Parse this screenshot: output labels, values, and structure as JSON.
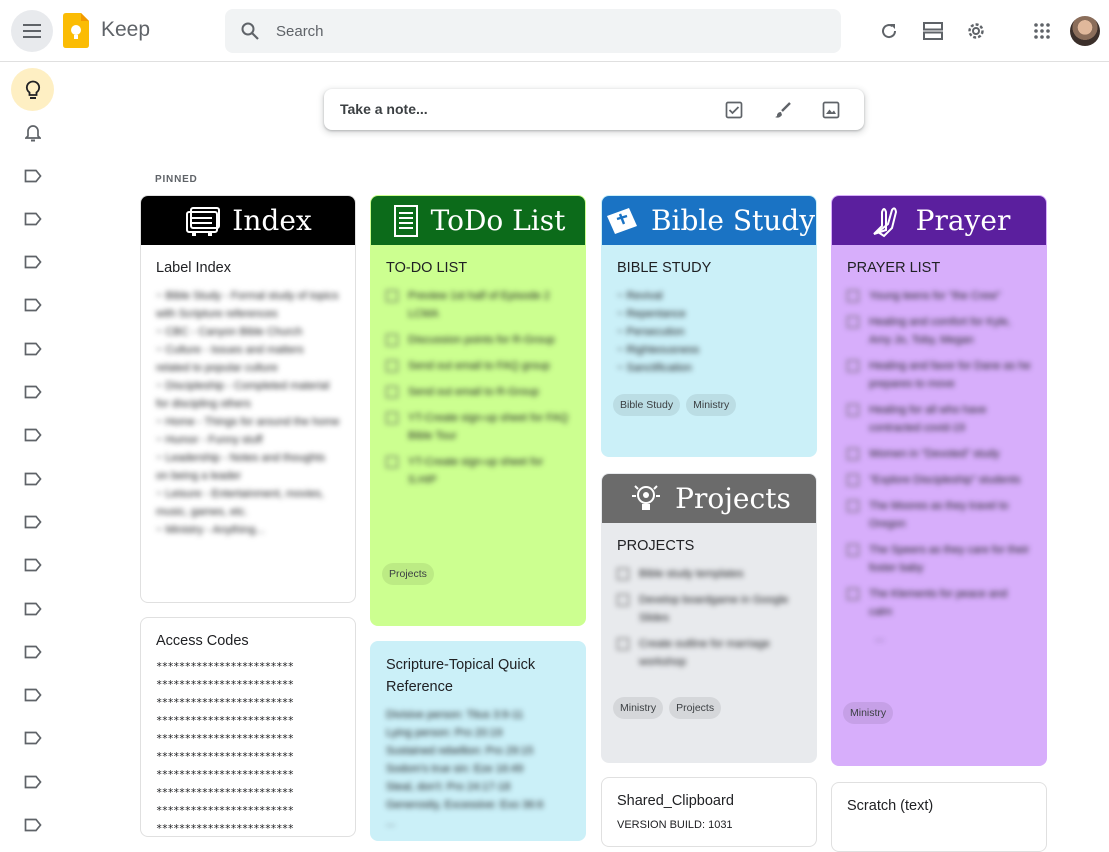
{
  "app": {
    "title": "Keep"
  },
  "search": {
    "placeholder": "Search"
  },
  "note_input": {
    "placeholder": "Take a note..."
  },
  "pinned_label": "PINNED",
  "colors": {
    "yellow_active": "#feefc3",
    "green": "#ccff90",
    "blue": "#cbf0f8",
    "gray": "#e8eaed",
    "purple": "#d7aefb"
  },
  "cards": {
    "index": {
      "banner": "Index",
      "title": "Label Index",
      "body": [
        "~ Bible Study - Formal study of topics with Scripture references",
        "~ CBC - Canyon Bible Church",
        "~ Culture - Issues and matters related to popular culture",
        "~ Discipleship - Completed material for discipling others",
        "~ Home - Things for around the home",
        "~ Humor - Funny stuff",
        "~ Leadership - Notes and thoughts on being a leader",
        "~ Leisure - Entertainment, movies, music, games, etc.",
        "~ Ministry - Anything..."
      ]
    },
    "todo": {
      "banner": "ToDo List",
      "title": "TO-DO LIST",
      "items": [
        "Preview 1st half of Episode 2 LCMA",
        "Discussion points for R-Group",
        "Send out email to FAQ group",
        "Send out email to R-Group",
        "YT-Create sign-up sheet for FAQ Bible Tour",
        "YT-Create sign-up sheet for S.HIP"
      ],
      "labels": [
        "Projects"
      ]
    },
    "bible": {
      "banner": "Bible Study",
      "title": "BIBLE STUDY",
      "items": [
        "~ Revival",
        "~ Repentance",
        "~ Persecution",
        "~ Righteousness",
        "~ Sanctification"
      ],
      "labels": [
        "Bible Study",
        "Ministry"
      ]
    },
    "prayer": {
      "banner": "Prayer",
      "title": "PRAYER LIST",
      "items": [
        "Young teens for \"the Crew\"",
        "Healing and comfort for Kyle, Amy Jo, Toby, Megan",
        "Healing and favor for Dane as he prepares to move",
        "Healing for all who have contracted covid-19",
        "Women in \"Devoted\" study",
        "\"Explore Discipleship\" students",
        "The Moores as they travel to Oregon",
        "The Speers as they care for their foster baby",
        "The Klements for peace and calm"
      ],
      "more": "...",
      "labels": [
        "Ministry"
      ]
    },
    "projects": {
      "banner": "Projects",
      "title": "PROJECTS",
      "items": [
        "Bible study templates",
        "Develop boardgame in Google Slides",
        "Create outline for marriage workshop"
      ],
      "labels": [
        "Ministry",
        "Projects"
      ]
    },
    "access": {
      "title": "Access Codes",
      "lines": [
        "************************",
        "************************",
        "************************",
        "************************",
        "************************",
        "************************",
        "************************",
        "************************",
        "************************",
        "************************"
      ]
    },
    "scripture": {
      "title": "Scripture-Topical Quick Reference",
      "body": [
        "Divisive person: Titus 3:9-11",
        "Lying person: Pro 20:19",
        "Sustained rebellion: Pro 29:15",
        "Sodom's true sin: Eze 16:49",
        "Steal, don't: Pro 24:17-18",
        "Generosity, Excessive: Exo 36:6",
        "..."
      ]
    },
    "clipboard": {
      "title": "Shared_Clipboard",
      "body": "VERSION BUILD: 1031"
    },
    "scratch": {
      "title": "Scratch (text)"
    }
  }
}
